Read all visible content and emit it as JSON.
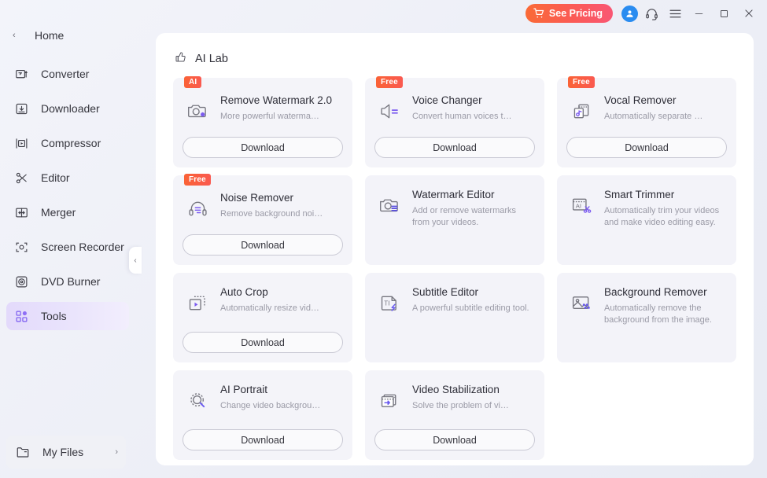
{
  "titlebar": {
    "pricing_label": "See Pricing",
    "cart_icon": "cart-icon",
    "avatar_icon": "user-avatar-icon",
    "support_icon": "headset-icon",
    "menu_icon": "hamburger-menu-icon",
    "minimize_label": "–",
    "maximize_label": "▭",
    "close_label": "✕"
  },
  "sidebar": {
    "home": {
      "label": "Home",
      "chevron": "‹"
    },
    "items": [
      {
        "label": "Converter",
        "icon": "converter-icon"
      },
      {
        "label": "Downloader",
        "icon": "downloader-icon"
      },
      {
        "label": "Compressor",
        "icon": "compressor-icon"
      },
      {
        "label": "Editor",
        "icon": "scissors-icon"
      },
      {
        "label": "Merger",
        "icon": "merger-icon"
      },
      {
        "label": "Screen Recorder",
        "icon": "screen-recorder-icon"
      },
      {
        "label": "DVD Burner",
        "icon": "dvd-burner-icon"
      },
      {
        "label": "Tools",
        "icon": "tools-icon",
        "active": true
      }
    ],
    "collapse": {
      "label": "‹"
    },
    "my_files": {
      "label": "My Files",
      "icon": "folder-icon",
      "arrow": "›"
    }
  },
  "main": {
    "section_title": "AI Lab",
    "section_icon": "thumbs-up-icon",
    "download_label": "Download",
    "cards": [
      {
        "name": "Remove Watermark 2.0",
        "desc": "More powerful waterma…",
        "badge": "AI",
        "icon": "camera-watermark-icon",
        "download": true,
        "multiline": false
      },
      {
        "name": "Voice Changer",
        "desc": "Convert human voices t…",
        "badge": "Free",
        "icon": "speaker-icon",
        "download": true,
        "multiline": false
      },
      {
        "name": "Vocal Remover",
        "desc": "Automatically separate …",
        "badge": "Free",
        "icon": "vocal-remover-icon",
        "download": true,
        "multiline": false
      },
      {
        "name": "Noise Remover",
        "desc": "Remove background noi…",
        "badge": "Free",
        "icon": "headphones-icon",
        "download": true,
        "multiline": false
      },
      {
        "name": "Watermark Editor",
        "desc": "Add or remove watermarks from your videos.",
        "badge": "",
        "icon": "camera-watermark-icon",
        "download": false,
        "multiline": true
      },
      {
        "name": "Smart Trimmer",
        "desc": "Automatically trim your videos and make video editing easy.",
        "badge": "",
        "icon": "smart-trimmer-icon",
        "download": false,
        "multiline": true
      },
      {
        "name": "Auto Crop",
        "desc": "Automatically resize vid…",
        "badge": "",
        "icon": "auto-crop-icon",
        "download": true,
        "multiline": false
      },
      {
        "name": "Subtitle Editor",
        "desc": "A powerful subtitle editing tool.",
        "badge": "",
        "icon": "subtitle-icon",
        "download": false,
        "multiline": true
      },
      {
        "name": "Background Remover",
        "desc": "Automatically remove the background from the image.",
        "badge": "",
        "icon": "background-remover-icon",
        "download": false,
        "multiline": true
      },
      {
        "name": "AI  Portrait",
        "desc": "Change video backgrou…",
        "badge": "",
        "icon": "ai-portrait-icon",
        "download": true,
        "multiline": false
      },
      {
        "name": "Video Stabilization",
        "desc": "Solve the problem of vi…",
        "badge": "",
        "icon": "video-stabilization-icon",
        "download": true,
        "multiline": false
      }
    ]
  },
  "colors": {
    "accent_orange": "#fa5a50",
    "accent_purple": "#7c5cf0",
    "avatar_blue": "#2a8cf0",
    "panel_bg": "#ffffff",
    "card_bg": "#f4f4f9",
    "app_bg": "#eceef6"
  }
}
